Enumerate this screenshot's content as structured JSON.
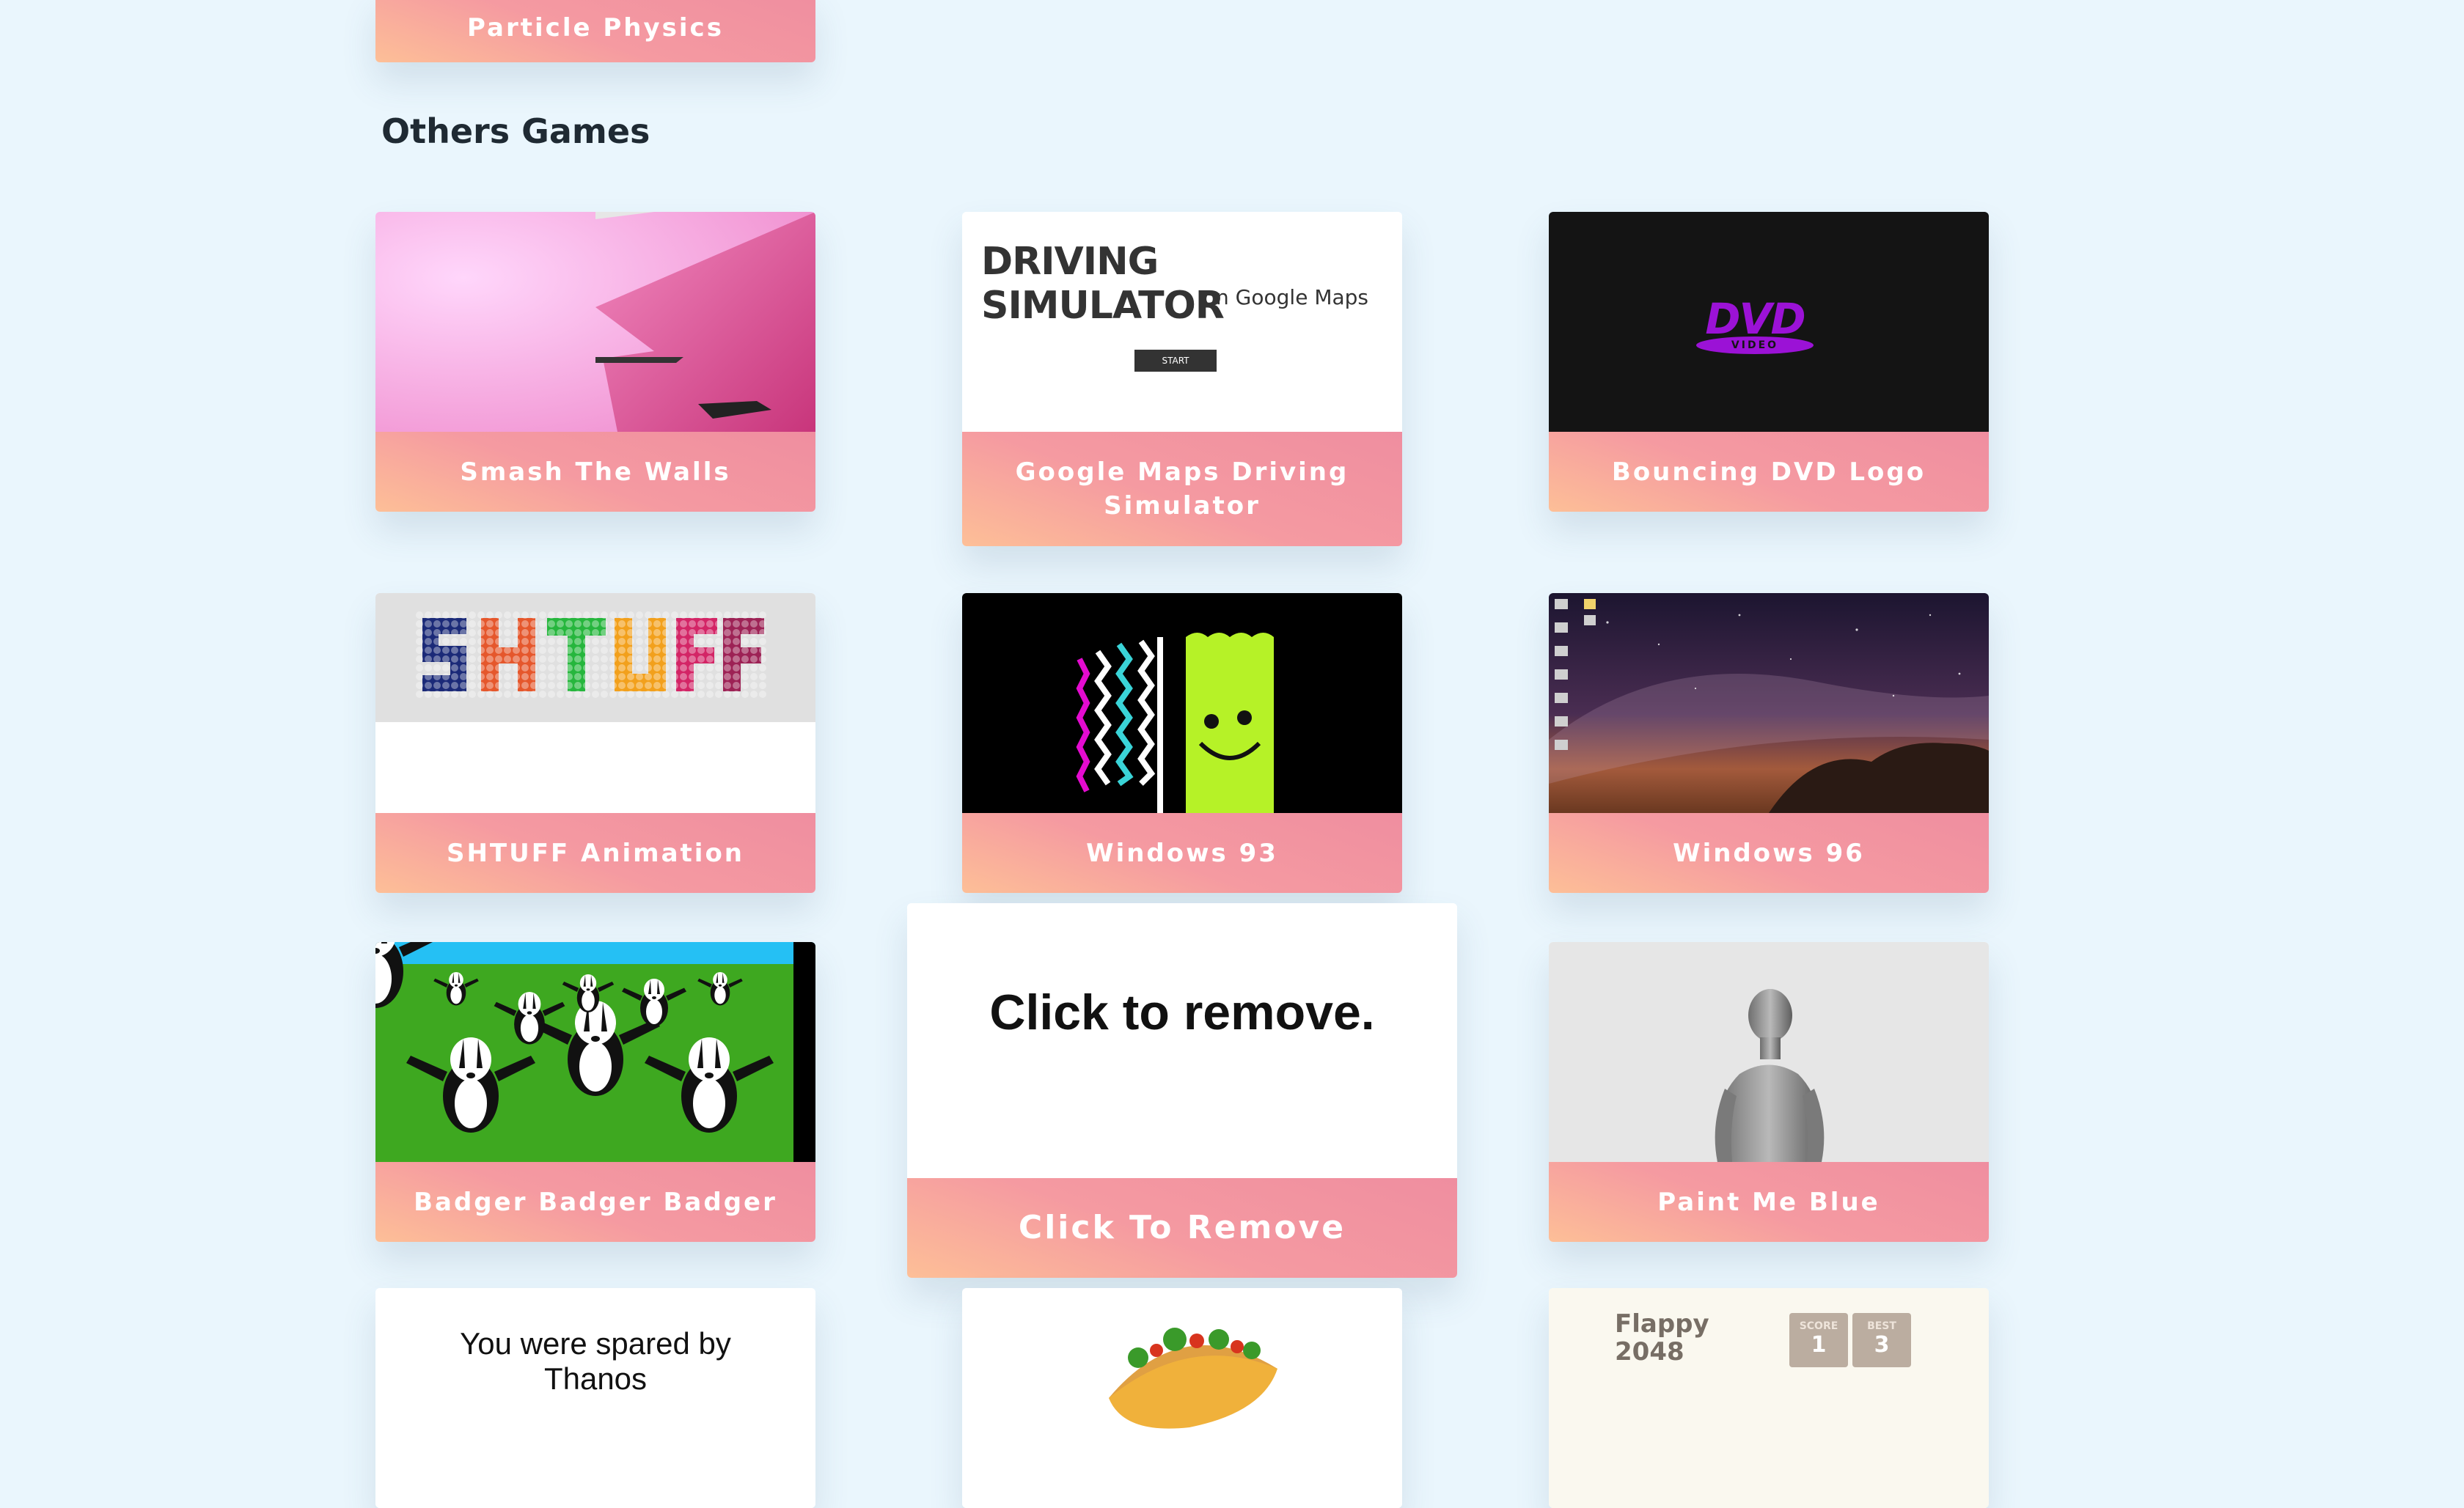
{
  "top_card": {
    "label": "Particle Physics"
  },
  "section": {
    "title": "Others Games"
  },
  "cards": {
    "smash": {
      "label": "Smash The Walls"
    },
    "driving": {
      "label": "Google Maps Driving Simulator",
      "thumb_title": "DRIVING SIMULATOR",
      "thumb_subtitle": "on Google Maps",
      "thumb_button": "START"
    },
    "dvd": {
      "label": "Bouncing DVD Logo",
      "thumb_logo": "DVD",
      "thumb_sub": "VIDEO"
    },
    "shtuff": {
      "label": "SHTUFF Animation",
      "thumb_text": "SHTUFF"
    },
    "win93": {
      "label": "Windows 93"
    },
    "win96": {
      "label": "Windows 96"
    },
    "badger": {
      "label": "Badger Badger Badger"
    },
    "remove": {
      "label": "Click To Remove",
      "thumb_text": "Click to remove."
    },
    "paint": {
      "label": "Paint Me Blue"
    },
    "thanos": {
      "thumb_text": "You were spared by Thanos"
    },
    "flappy": {
      "thumb_title": "Flappy 2048",
      "score_label": "SCORE",
      "score_value": "1",
      "best_label": "BEST",
      "best_value": "3"
    }
  },
  "colors": {
    "background": "#eaf6fd",
    "label_gradient_start": "#fdbf97",
    "label_gradient_end": "#ef8ea0"
  }
}
